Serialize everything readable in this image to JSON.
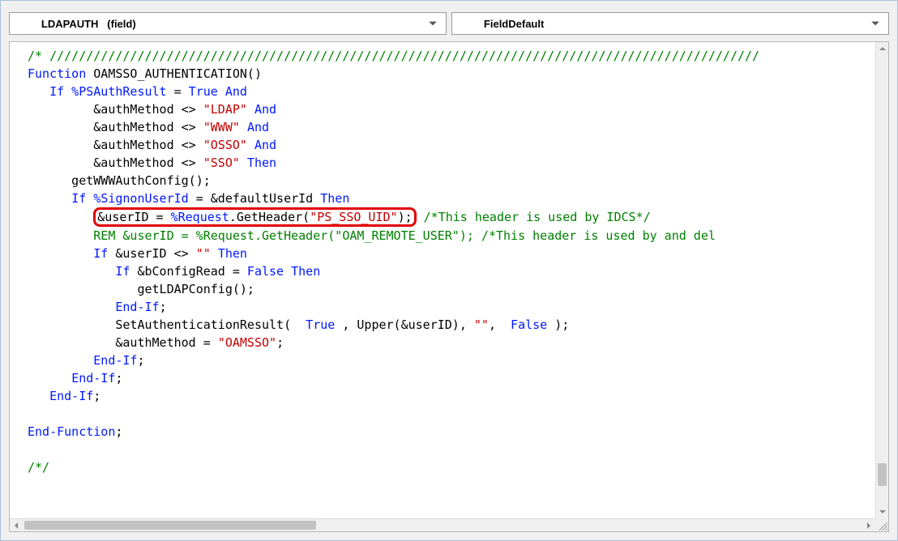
{
  "dropdowns": {
    "left_bold": "LDAPAUTH",
    "left_secondary": "(field)",
    "right": "FieldDefault"
  },
  "code": {
    "comment_bar": "/* /////////////////////////////////////////////////////////////////////////////////////////////////",
    "fn_kw": "Function",
    "fn_name": " OAMSSO_AUTHENTICATION()",
    "if1_kw": "If",
    "psauth": " %PSAuthResult ",
    "eq": "=",
    "true": " True ",
    "and": "And",
    "am_lhs1": "         &authMethod ",
    "ne": "<>",
    "s_ldap": " \"LDAP\" ",
    "am_lhs2": "         &authMethod ",
    "s_www": " \"WWW\" ",
    "am_lhs3": "         &authMethod ",
    "s_osso": " \"OSSO\" ",
    "am_lhs4": "         &authMethod ",
    "s_sso": " \"SSO\" ",
    "then": "Then",
    "getwww": "      getWWWAuthConfig();",
    "if2_kw": "If",
    "signon": " %SignonUserId ",
    "default": " &defaultUserId ",
    "hl_line": "&userID = %Request.GetHeader(\"PS_SSO_UID\");",
    "hl_comment": " /*This header is used by IDCS*/",
    "rem_line_a": "REM",
    "rem_line_b": " &userID = %Request.GetHeader(\"OAM_REMOTE_USER\"); /*This header is used by and del",
    "if3_kw": "If",
    "userid": " &userID ",
    "empty": " \"\" ",
    "if4_kw": "If",
    "bconfig": " &bConfigRead ",
    "false": " False ",
    "getldap": "               getLDAPConfig();",
    "endif1": "End-If",
    "setauth_a": "            SetAuthenticationResult( ",
    "setauth_b": ", Upper(&userID), ",
    "setauth_c": ", ",
    "setauth_d": ");",
    "am_assign": "            &authMethod ",
    "s_oamsso": " \"OAMSSO\"",
    "endif2": "End-If",
    "endif3": "End-If",
    "endif4": "End-If",
    "endfn": "End-Function",
    "bottom_comment_start": "/*/"
  }
}
